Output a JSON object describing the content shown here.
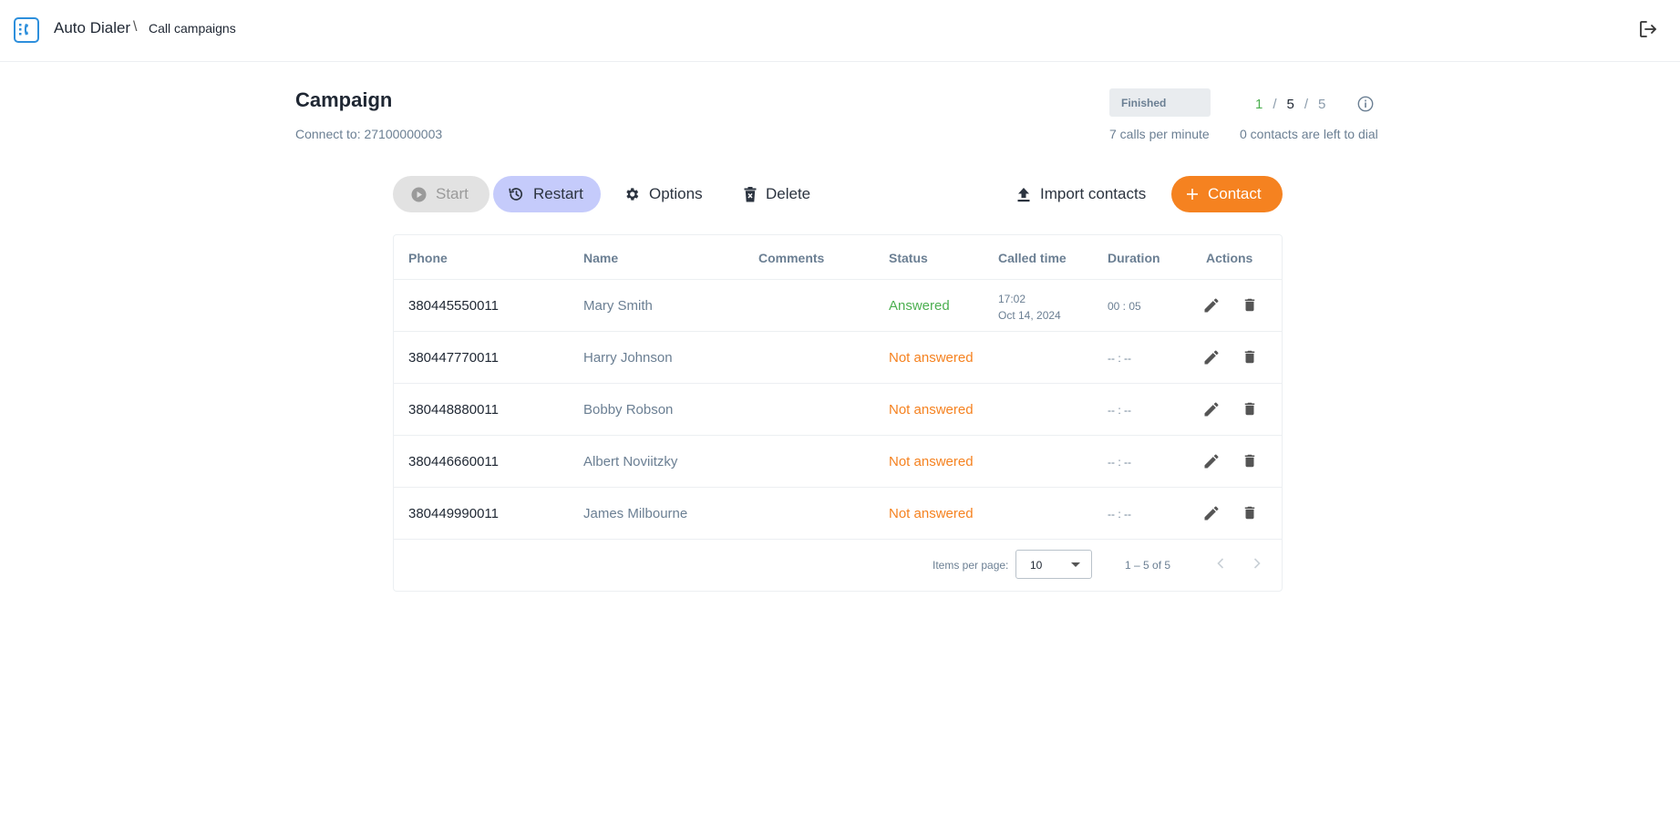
{
  "header": {
    "app_title": "Auto Dialer",
    "separator": "\\",
    "breadcrumb": "Call campaigns",
    "logo_icon": "phone-logo-icon",
    "logout_icon": "logout-icon"
  },
  "campaign": {
    "title": "Campaign",
    "connect_to": "Connect to: 27100000003",
    "status": "Finished",
    "calls_per_minute": "7 calls per minute",
    "counters": {
      "completed": "1",
      "total": "5",
      "all": "5",
      "separator": "/"
    },
    "contacts_left": "0 contacts are left to dial"
  },
  "toolbar": {
    "start_label": "Start",
    "restart_label": "Restart",
    "options_label": "Options",
    "delete_label": "Delete",
    "import_label": "Import contacts",
    "contact_label": "Contact"
  },
  "table": {
    "columns": [
      "Phone",
      "Name",
      "Comments",
      "Status",
      "Called time",
      "Duration",
      "Actions"
    ],
    "rows": [
      {
        "phone": "380445550011",
        "name": "Mary Smith",
        "comments": "",
        "status": "Answered",
        "called_time": "17:02",
        "called_date": "Oct 14, 2024",
        "duration": "00 : 05"
      },
      {
        "phone": "380447770011",
        "name": "Harry Johnson",
        "comments": "",
        "status": "Not answered",
        "called_time": "",
        "called_date": "",
        "duration": "-- : --"
      },
      {
        "phone": "380448880011",
        "name": "Bobby Robson",
        "comments": "",
        "status": "Not answered",
        "called_time": "",
        "called_date": "",
        "duration": "-- : --"
      },
      {
        "phone": "380446660011",
        "name": "Albert Noviitzky",
        "comments": "",
        "status": "Not answered",
        "called_time": "",
        "called_date": "",
        "duration": "-- : --"
      },
      {
        "phone": "380449990011",
        "name": "James Milbourne",
        "comments": "",
        "status": "Not answered",
        "called_time": "",
        "called_date": "",
        "duration": "-- : --"
      }
    ]
  },
  "paginator": {
    "items_per_page_label": "Items per page:",
    "items_per_page_value": "10",
    "range": "1 – 5 of 5"
  },
  "colors": {
    "accent_orange": "#f58220",
    "answered_green": "#4caf50",
    "restart_bg": "#c5cbfb",
    "logo_blue": "#2d8fdc"
  }
}
